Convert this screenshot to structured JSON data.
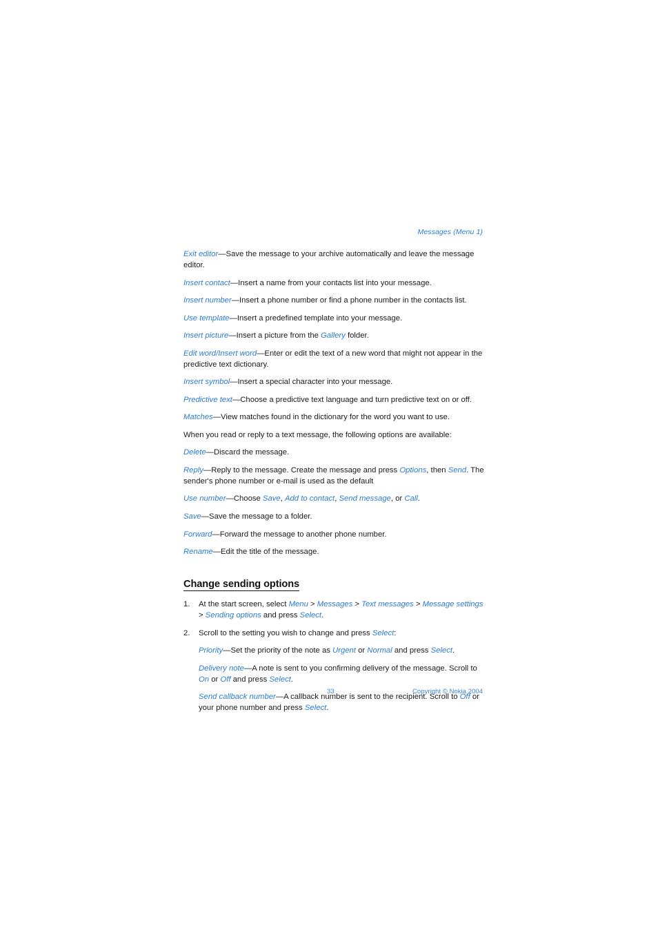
{
  "document": {
    "running_header": "Messages (Menu 1)",
    "page_number": "33",
    "copyright": "Copyright © Nokia 2004",
    "accent_color": "#2b7bd4",
    "text_color": "#1a1a1a"
  },
  "options_editor": {
    "exit_editor": {
      "term": "Exit editor",
      "dash": "—",
      "description": "Save the message to your archive automatically and leave the message editor."
    },
    "insert_contact": {
      "term": "Insert contact",
      "dash": "—",
      "description": "Insert a name from your contacts list into your message."
    },
    "insert_number": {
      "term": "Insert number",
      "dash": "—",
      "description": "Insert a phone number or find a phone number in the contacts list."
    },
    "use_template": {
      "term": "Use template",
      "dash": "—",
      "description": "Insert a predefined template into your message."
    },
    "insert_picture": {
      "term": "Insert picture",
      "dash": "—",
      "desc_before": "Insert a picture from the ",
      "ref_gallery": "Gallery",
      "desc_after": " folder."
    },
    "edit_word": {
      "term_a": "Edit word",
      "separator": "/",
      "term_b": "Insert word",
      "dash": "—",
      "description": "Enter or edit the text of a new word that might not appear in the predictive text dictionary."
    },
    "insert_symbol": {
      "term": "Insert symbol",
      "dash": "—",
      "description": "Insert a special character into your message."
    },
    "predictive_text": {
      "term": "Predictive text",
      "dash": "—",
      "description": "Choose a predictive text language and turn predictive text on or off."
    },
    "matches": {
      "term": "Matches",
      "dash": "—",
      "description": "View matches found in the dictionary for the word you want to use."
    }
  },
  "read_reply_intro": "When you read or reply to a text message, the following options are available:",
  "options_read": {
    "delete": {
      "term": "Delete",
      "dash": "—",
      "description": "Discard the message."
    },
    "reply": {
      "term": "Reply",
      "dash": "—",
      "part1": "Reply to the message. Create the message and press ",
      "ref_options": "Options",
      "part2": ", then ",
      "ref_send": "Send",
      "part3": ". The sender's phone number or e-mail is used as the default"
    },
    "use_number": {
      "term": "Use number",
      "dash": "—",
      "part1": "Choose ",
      "ref_save": "Save",
      "sep1": ", ",
      "ref_add_to_contact": "Add to contact",
      "sep2": ", ",
      "ref_send_message": "Send message",
      "sep3": ", or ",
      "ref_call": "Call",
      "part_end": "."
    },
    "save": {
      "term": "Save",
      "dash": "—",
      "description": "Save the message to a folder."
    },
    "forward": {
      "term": "Forward",
      "dash": "—",
      "description": "Forward the message to another phone number."
    },
    "rename": {
      "term": "Rename",
      "dash": "—",
      "description": "Edit the title of the message."
    }
  },
  "change_sending_options": {
    "heading": "Change sending options",
    "step1": {
      "number": "1.",
      "part1": "At the start screen, select ",
      "ref_menu": "Menu",
      "sep1": " > ",
      "ref_messages": "Messages",
      "sep2": " > ",
      "ref_text_messages": "Text messages",
      "sep3": " > ",
      "ref_message_settings": "Message settings",
      "sep4": " > ",
      "ref_sending_options": "Sending options",
      "part2": " and press ",
      "ref_select": "Select",
      "part_end": "."
    },
    "step2": {
      "number": "2.",
      "part1": "Scroll to the setting you wish to change and press ",
      "ref_select": "Select",
      "part_end": ":",
      "priority": {
        "term": "Priority",
        "dash": "—",
        "part1": "Set the priority of the note as ",
        "ref_urgent": "Urgent",
        "part2": " or ",
        "ref_normal": "Normal",
        "part3": " and press ",
        "ref_select": "Select",
        "part_end": "."
      },
      "delivery_note": {
        "term": "Delivery note",
        "dash": "—",
        "part1": "A note is sent to you confirming delivery of the message. Scroll to ",
        "ref_on": "On",
        "part2": " or ",
        "ref_off": "Off",
        "part3": " and press ",
        "ref_select": "Select",
        "part_end": "."
      },
      "send_callback_number": {
        "term": "Send callback number",
        "dash": "—",
        "part1": "A callback number is sent to the recipient. Scroll to ",
        "ref_off": "Off",
        "part2": " or your phone number and press ",
        "ref_select": "Select",
        "part_end": "."
      }
    }
  }
}
